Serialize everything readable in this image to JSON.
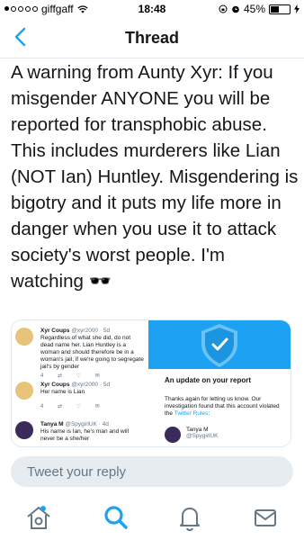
{
  "status": {
    "carrier": "giffgaff",
    "time": "18:48",
    "battery": "45%",
    "battery_level": 0.45
  },
  "nav": {
    "title": "Thread",
    "back_icon": "chevron-left-icon"
  },
  "tweet": {
    "text": "A warning from Aunty Xyr: If you misgender ANYONE you will be reported for transphobic abuse. This includes murderers like Lian (NOT Ian) Huntley. Misgendering is bigotry and it puts my life more in danger when you use it to attack society's worst people. I'm watching 🕶️"
  },
  "media": {
    "tweets": [
      {
        "name": "Xyr Coups",
        "handle": "@xyr2000 · 5d",
        "text": "Regardless of what she did, do not dead name her. Lian Huntley is a woman and should therefore be in a woman's jail, if we're going to segregate jail's by gender",
        "acts": [
          "4",
          "",
          "",
          ""
        ]
      },
      {
        "name": "Xyr Coups",
        "handle": "@xyr2000 · 5d",
        "text": "Her name is Lian",
        "acts": [
          "4",
          "",
          "",
          ""
        ]
      },
      {
        "name": "Tanya M",
        "handle": "@SpygirlUK · 4d",
        "text": "His name is Ian, he's man and will never be a she/her"
      }
    ],
    "report": {
      "title": "An update on your report",
      "text": "Thanks again for letting us know. Our investigation found that this account violated the ",
      "link": "Twitter Rules",
      "suffix": ":",
      "user_name": "Tanya M",
      "user_handle": "@SpygirlUK"
    }
  },
  "reply": {
    "placeholder": "Tweet your reply"
  },
  "tabs": [
    "home-icon",
    "search-icon",
    "notifications-icon",
    "messages-icon"
  ],
  "colors": {
    "accent": "#1da1f2",
    "text": "#14171a",
    "muted": "#657786"
  }
}
